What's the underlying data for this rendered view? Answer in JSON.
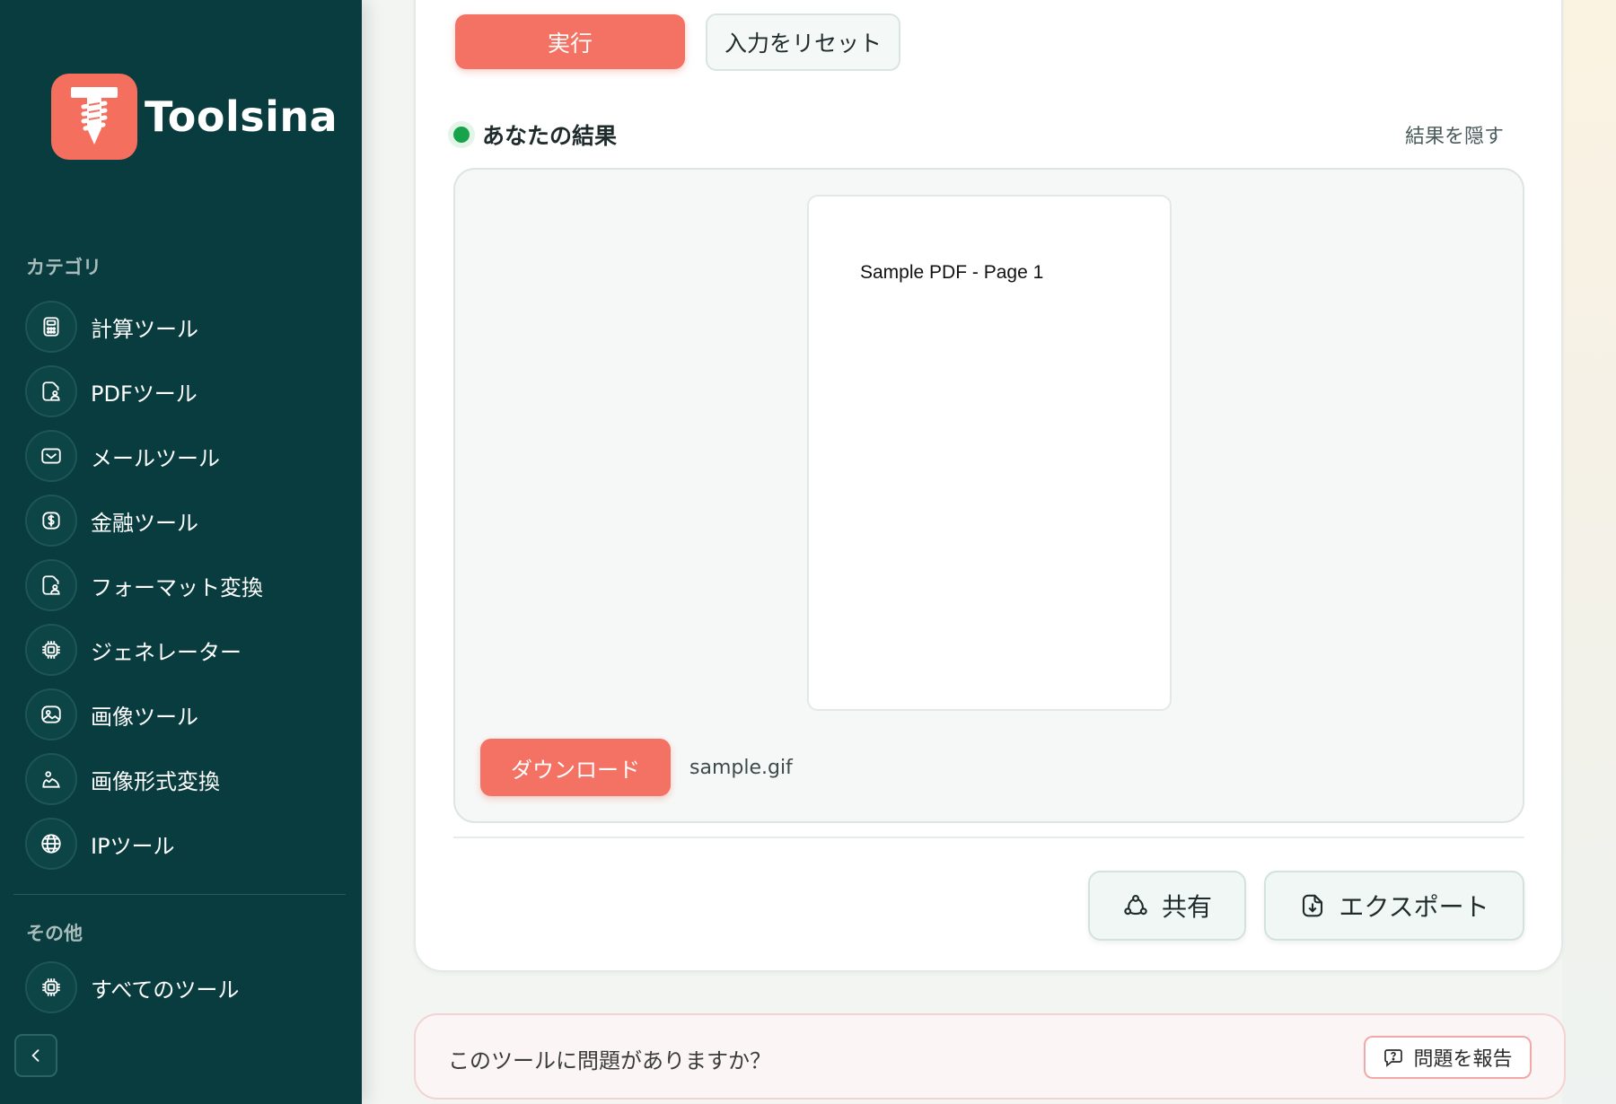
{
  "brand": {
    "name": "Toolsina"
  },
  "sidebar": {
    "category_heading": "カテゴリ",
    "items": [
      {
        "label": "計算ツール",
        "icon": "calculator-icon"
      },
      {
        "label": "PDFツール",
        "icon": "pdf-file-icon"
      },
      {
        "label": "メールツール",
        "icon": "mail-icon"
      },
      {
        "label": "金融ツール",
        "icon": "dollar-icon"
      },
      {
        "label": "フォーマット変換",
        "icon": "format-convert-icon"
      },
      {
        "label": "ジェネレーター",
        "icon": "chip-icon"
      },
      {
        "label": "画像ツール",
        "icon": "image-icon"
      },
      {
        "label": "画像形式変換",
        "icon": "image-convert-icon"
      },
      {
        "label": "IPツール",
        "icon": "globe-icon"
      }
    ],
    "other_heading": "その他",
    "other_items": [
      {
        "label": "すべてのツール",
        "icon": "chip-icon"
      }
    ]
  },
  "actions": {
    "run_label": "実行",
    "reset_label": "入力をリセット"
  },
  "result": {
    "title": "あなたの結果",
    "hide_label": "結果を隠す",
    "preview_text": "Sample PDF - Page 1",
    "download_label": "ダウンロード",
    "filename": "sample.gif",
    "share_label": "共有",
    "export_label": "エクスポート"
  },
  "report": {
    "question": "このツールに問題がありますか？",
    "button_label": "問題を報告"
  },
  "colors": {
    "sidebar_bg": "#093c3e",
    "accent": "#f47264",
    "status_dot": "#16a34a"
  }
}
